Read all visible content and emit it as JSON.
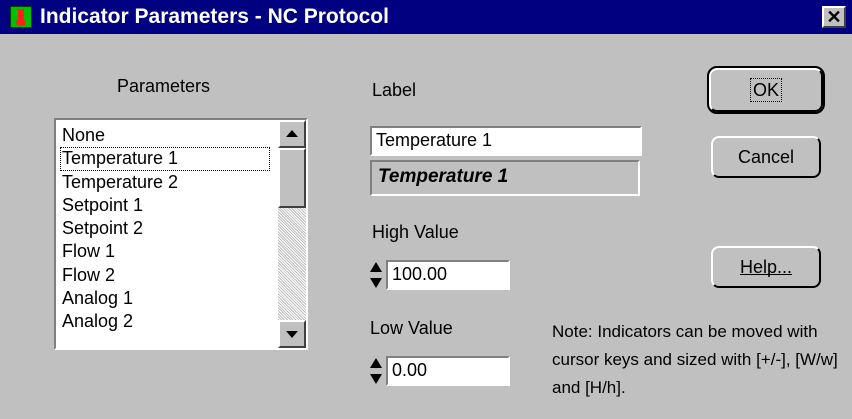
{
  "window": {
    "title": "Indicator Parameters - NC Protocol",
    "icon": "thermometer-icon",
    "close_glyph": "✕"
  },
  "parameters": {
    "heading": "Parameters",
    "items": [
      "None",
      "Temperature 1",
      "Temperature 2",
      "Setpoint 1",
      "Setpoint 2",
      "Flow 1",
      "Flow 2",
      "Analog 1",
      "Analog 2"
    ],
    "selected": "Temperature 1"
  },
  "label": {
    "heading": "Label",
    "value": "Temperature 1",
    "preview": "Temperature 1"
  },
  "high_value": {
    "heading": "High Value",
    "value": "100.00"
  },
  "low_value": {
    "heading": "Low Value",
    "value": "0.00"
  },
  "buttons": {
    "ok": "OK",
    "cancel": "Cancel",
    "help": "Help..."
  },
  "note": {
    "text": "Note:  Indicators can be moved with cursor keys and sized with [+/-], [W/w] and [H/h]."
  }
}
